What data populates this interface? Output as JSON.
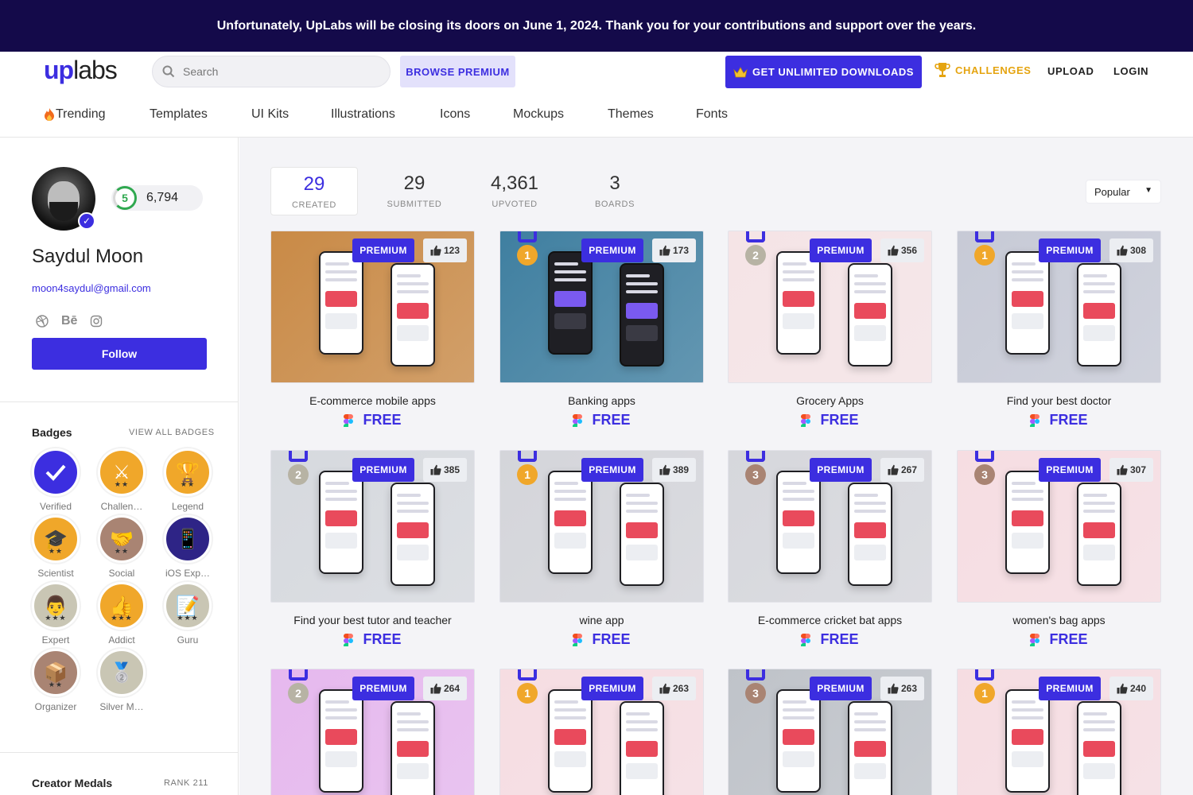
{
  "banner": {
    "text": "Unfortunately, UpLabs will be closing its doors on June 1, 2024. Thank you for your contributions and support over the years."
  },
  "header": {
    "logo_up": "up",
    "logo_labs": "labs",
    "search_placeholder": "Search",
    "browse_premium": "BROWSE PREMIUM",
    "get_unlimited": "GET UNLIMITED DOWNLOADS",
    "challenges": "CHALLENGES",
    "upload": "UPLOAD",
    "login": "LOGIN"
  },
  "categories": [
    "Trending",
    "Templates",
    "UI Kits",
    "Illustrations",
    "Icons",
    "Mockups",
    "Themes",
    "Fonts"
  ],
  "profile": {
    "level": "5",
    "points": "6,794",
    "name": "Saydul Moon",
    "email": "moon4saydul@gmail.com",
    "follow": "Follow"
  },
  "badges_section": {
    "title": "Badges",
    "view_all": "VIEW ALL BADGES",
    "items": [
      {
        "label": "Verified",
        "icon": "check-icon",
        "color": "#3c2ee0"
      },
      {
        "label": "Challen…",
        "icon": "swords-icon",
        "color": "#f0a72a"
      },
      {
        "label": "Legend",
        "icon": "trophy-icon",
        "color": "#f0a72a"
      },
      {
        "label": "Scientist",
        "icon": "graduation-cap-icon",
        "color": "#f0a72a"
      },
      {
        "label": "Social",
        "icon": "handshake-icon",
        "color": "#a98473"
      },
      {
        "label": "iOS Exp…",
        "icon": "phone-icon",
        "color": "#2e2486"
      },
      {
        "label": "Expert",
        "icon": "person-icon",
        "color": "#c9c6b4"
      },
      {
        "label": "Addict",
        "icon": "thumbs-up-icon",
        "color": "#f0a72a"
      },
      {
        "label": "Guru",
        "icon": "memo-icon",
        "color": "#c9c6b4"
      },
      {
        "label": "Organizer",
        "icon": "box-icon",
        "color": "#a98473"
      },
      {
        "label": "Silver M…",
        "icon": "medal-icon",
        "color": "#c9c6b4"
      }
    ]
  },
  "medals_section": {
    "title": "Creator Medals",
    "rank": "RANK 211"
  },
  "stats": [
    {
      "value": "29",
      "label": "CREATED"
    },
    {
      "value": "29",
      "label": "SUBMITTED"
    },
    {
      "value": "4,361",
      "label": "UPVOTED"
    },
    {
      "value": "3",
      "label": "BOARDS"
    }
  ],
  "sort": {
    "selected": "Popular"
  },
  "premium_label": "PREMIUM",
  "cards": [
    {
      "title": "E-commerce mobile apps",
      "likes": "123",
      "price": "FREE",
      "medal": "",
      "bg": "#c98a46"
    },
    {
      "title": "Banking apps",
      "likes": "173",
      "price": "FREE",
      "medal": "1",
      "bg": "#3f7fa0"
    },
    {
      "title": "Grocery Apps",
      "likes": "356",
      "price": "FREE",
      "medal": "2",
      "bg": "#f5e4e6"
    },
    {
      "title": "Find your best doctor",
      "likes": "308",
      "price": "FREE",
      "medal": "1",
      "bg": "#c7cad6"
    },
    {
      "title": "Find your best tutor and teacher",
      "likes": "385",
      "price": "FREE",
      "medal": "2",
      "bg": "#d6d9de"
    },
    {
      "title": "wine app",
      "likes": "389",
      "price": "FREE",
      "medal": "1",
      "bg": "#d4d5da"
    },
    {
      "title": "E-commerce cricket bat apps",
      "likes": "267",
      "price": "FREE",
      "medal": "3",
      "bg": "#d6d7dc"
    },
    {
      "title": "women's bag apps",
      "likes": "307",
      "price": "FREE",
      "medal": "3",
      "bg": "#f6dde2"
    },
    {
      "title": "",
      "likes": "264",
      "price": "",
      "medal": "2",
      "bg": "#e6b8ee"
    },
    {
      "title": "",
      "likes": "263",
      "price": "",
      "medal": "1",
      "bg": "#f6dde2"
    },
    {
      "title": "",
      "likes": "263",
      "price": "",
      "medal": "3",
      "bg": "#bfc3c9"
    },
    {
      "title": "",
      "likes": "240",
      "price": "",
      "medal": "1",
      "bg": "#f6dde2"
    }
  ],
  "colors": {
    "accent": "#3c2ee0",
    "banner": "#140a4a",
    "challenges": "#e5a410",
    "gold": "#f0a72a",
    "silver": "#b7b3a4",
    "bronze": "#a98473"
  }
}
